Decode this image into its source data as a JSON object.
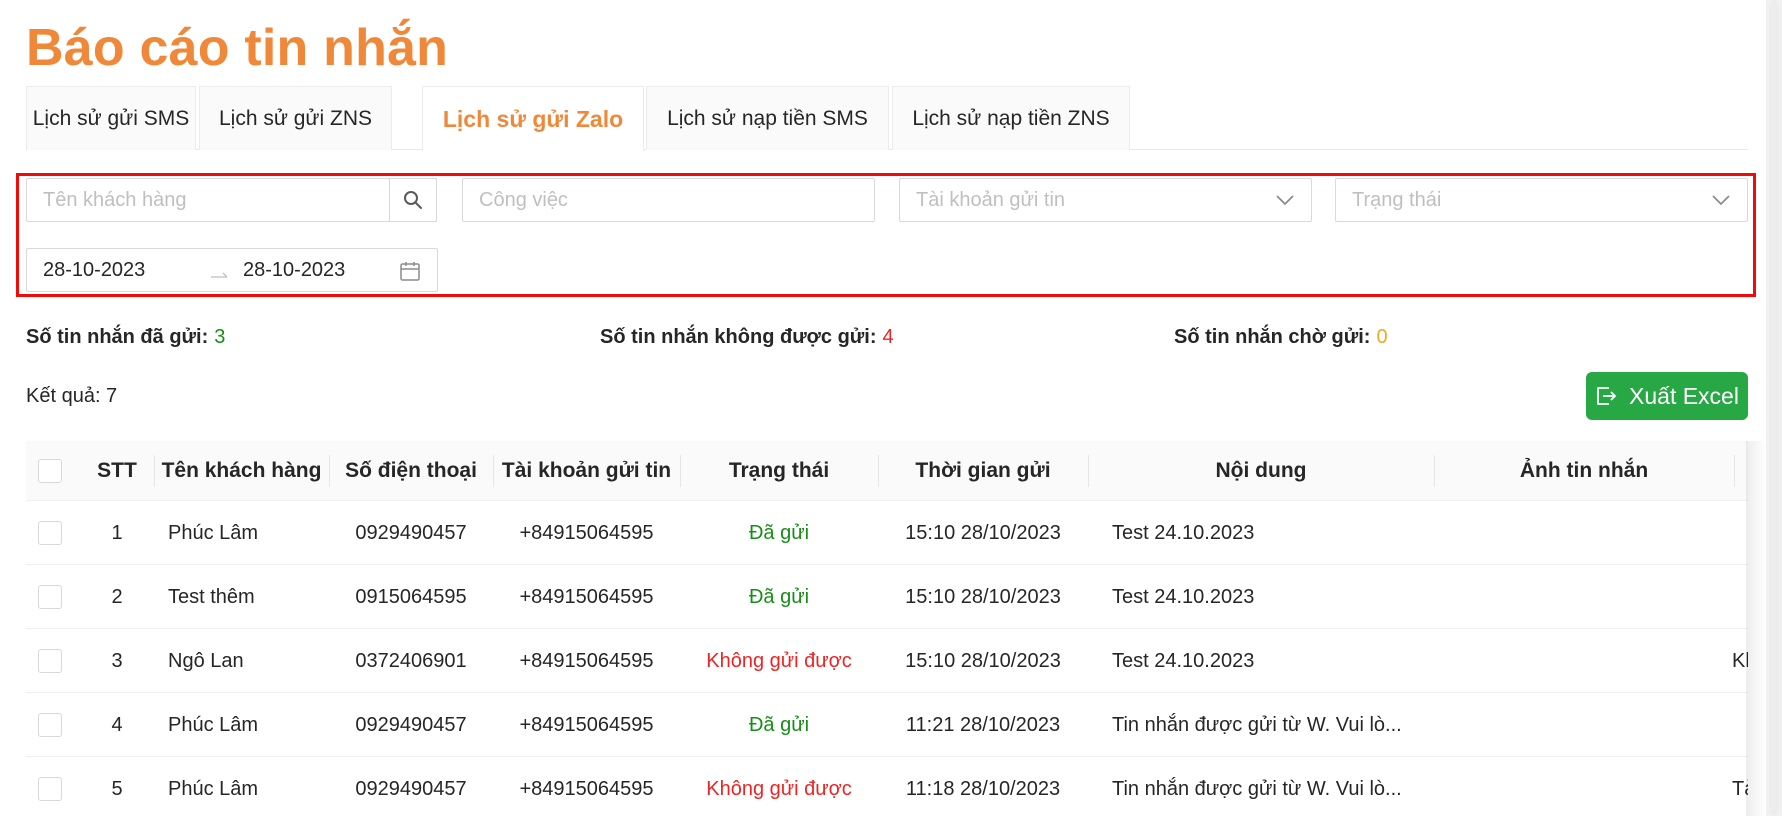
{
  "title": "Báo cáo tin nhắn",
  "tabs": [
    {
      "label": "Lịch sử gửi SMS"
    },
    {
      "label": "Lịch sử gửi ZNS"
    },
    {
      "label": "Lịch sử gửi Zalo"
    },
    {
      "label": "Lịch sử nạp tiền SMS"
    },
    {
      "label": "Lịch sử nạp tiền ZNS"
    }
  ],
  "active_tab": "Lịch sử gửi Zalo",
  "filters": {
    "customer_placeholder": "Tên khách hàng",
    "job_placeholder": "Công việc",
    "account_placeholder": "Tài khoản gửi tin",
    "status_placeholder": "Trạng thái",
    "date_from": "28-10-2023",
    "date_to": "28-10-2023"
  },
  "stats": {
    "sent_label": "Số tin nhắn đã gửi:",
    "sent_value": "3",
    "failed_label": "Số tin nhắn không được gửi:",
    "failed_value": "4",
    "pending_label": "Số tin nhắn chờ gửi:",
    "pending_value": "0"
  },
  "result_label": "Kết quả: 7",
  "export_label": "Xuất Excel",
  "colors": {
    "accent": "#f0883a",
    "success": "#178f17",
    "danger": "#ee2424",
    "warning": "#f5a623",
    "excel_button": "#28a745",
    "highlight_box": "#f00a0a"
  },
  "table": {
    "headers": [
      "STT",
      "Tên khách hàng",
      "Số điện thoại",
      "Tài khoản gửi tin",
      "Trạng thái",
      "Thời gian gửi",
      "Nội dung",
      "Ảnh tin nhắn"
    ],
    "rows": [
      {
        "stt": "1",
        "name": "Phúc Lâm",
        "phone": "0929490457",
        "account": "+84915064595",
        "status": "Đã gửi",
        "status_type": "ok",
        "time": "15:10 28/10/2023",
        "content": "Test 24.10.2023",
        "extra": ""
      },
      {
        "stt": "2",
        "name": "Test thêm",
        "phone": "0915064595",
        "account": "+84915064595",
        "status": "Đã gửi",
        "status_type": "ok",
        "time": "15:10 28/10/2023",
        "content": "Test 24.10.2023",
        "extra": ""
      },
      {
        "stt": "3",
        "name": "Ngô Lan",
        "phone": "0372406901",
        "account": "+84915064595",
        "status": "Không gửi được",
        "status_type": "fail",
        "time": "15:10 28/10/2023",
        "content": "Test 24.10.2023",
        "extra": "Kl"
      },
      {
        "stt": "4",
        "name": "Phúc Lâm",
        "phone": "0929490457",
        "account": "+84915064595",
        "status": "Đã gửi",
        "status_type": "ok",
        "time": "11:21 28/10/2023",
        "content": "Tin nhắn được gửi từ W. Vui lò...",
        "extra": ""
      },
      {
        "stt": "5",
        "name": "Phúc Lâm",
        "phone": "0929490457",
        "account": "+84915064595",
        "status": "Không gửi được",
        "status_type": "fail",
        "time": "11:18 28/10/2023",
        "content": "Tin nhắn được gửi từ W. Vui lò...",
        "extra": "Tà"
      }
    ]
  },
  "icons": {
    "search": "search-icon",
    "chevron": "chevron-down-icon",
    "calendar": "calendar-icon",
    "export": "export-icon"
  }
}
